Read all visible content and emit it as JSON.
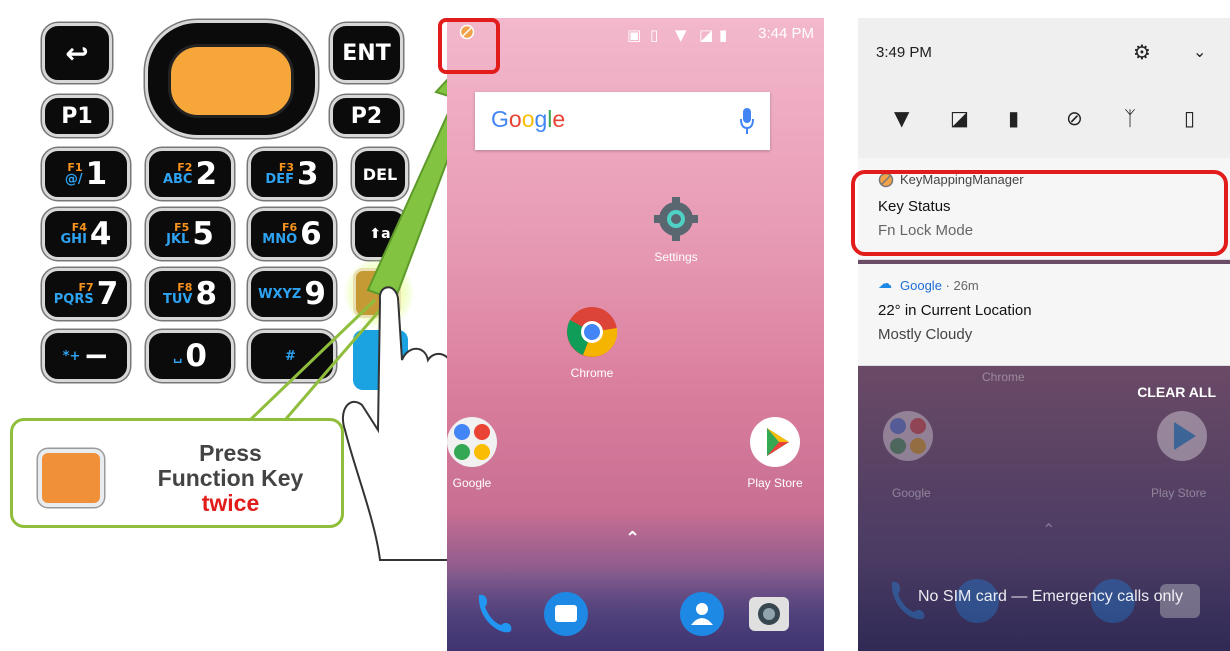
{
  "keypad": {
    "back_label": "↩",
    "enter_label": "ENT",
    "p1_label": "P1",
    "p2_label": "P2",
    "del_label": "DEL",
    "shift_label": "⬆a",
    "keys": [
      {
        "fn": "F1",
        "alpha": "@/",
        "digit": "1"
      },
      {
        "fn": "F2",
        "alpha": "ABC",
        "digit": "2"
      },
      {
        "fn": "F3",
        "alpha": "DEF",
        "digit": "3"
      },
      {
        "fn": "F4",
        "alpha": "GHI",
        "digit": "4"
      },
      {
        "fn": "F5",
        "alpha": "JKL",
        "digit": "5"
      },
      {
        "fn": "F6",
        "alpha": "MNO",
        "digit": "6"
      },
      {
        "fn": "F7",
        "alpha": "PQRS",
        "digit": "7"
      },
      {
        "fn": "F8",
        "alpha": "TUV",
        "digit": "8"
      },
      {
        "fn": "",
        "alpha": "WXYZ",
        "digit": "9"
      },
      {
        "fn": "",
        "alpha": "*+",
        "digit": "−"
      },
      {
        "fn": "",
        "alpha": "␣",
        "digit": "0"
      },
      {
        "fn": "",
        "alpha": "#",
        "digit": ""
      }
    ]
  },
  "callout": {
    "line1": "Press",
    "line2": "Function Key",
    "line3": "twice"
  },
  "phone1": {
    "time": "3:44 PM",
    "search_brand": "Google",
    "apps": {
      "settings": "Settings",
      "chrome": "Chrome",
      "google": "Google",
      "play_store": "Play Store"
    }
  },
  "phone2": {
    "time": "3:49 PM",
    "notification1": {
      "app": "KeyMappingManager",
      "title": "Key Status",
      "text": "Fn Lock Mode"
    },
    "notification2": {
      "app": "Google",
      "age": " · 26m",
      "title": "22° in Current Location",
      "text": "Mostly Cloudy"
    },
    "clear_all": "CLEAR ALL",
    "dim_apps": {
      "chrome": "Chrome",
      "google": "Google",
      "play_store": "Play Store"
    },
    "no_sim": "No SIM card — Emergency calls only"
  },
  "colors": {
    "highlight_red": "#e21b1b",
    "callout_green": "#8fbd3c",
    "function_key_orange": "#f0913a"
  }
}
